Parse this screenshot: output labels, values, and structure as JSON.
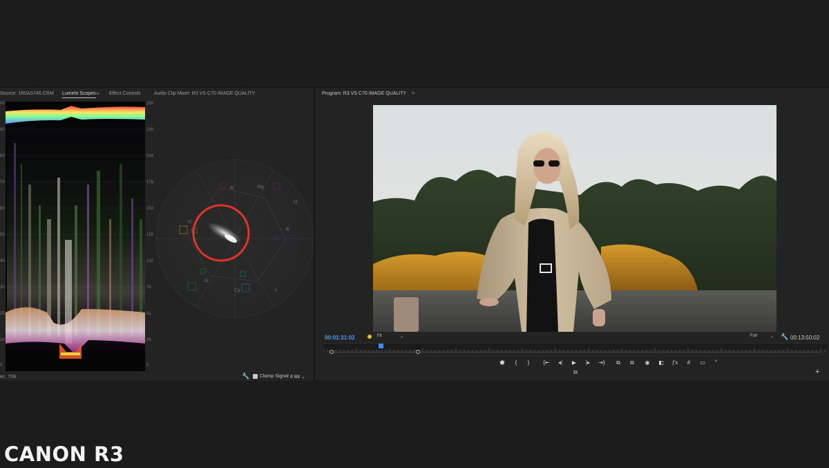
{
  "caption": "CANON R3",
  "source_panel": {
    "tabs": {
      "source": "Source: 1R0AS745.CRM",
      "lumetri": "Lumetri Scopes",
      "effect_controls": "Effect Controls",
      "audio_mixer": "Audio Clip Mixer: R3 VS C70 IMAGE QUALITY"
    },
    "waveform": {
      "right_ticks": [
        "255",
        "230",
        "204",
        "178",
        "153",
        "128",
        "102",
        "76",
        "51",
        "26",
        "0"
      ],
      "left_ticks": [
        "00",
        "90",
        "80",
        "70",
        "60",
        "50",
        "40",
        "30",
        "20",
        "10",
        "0"
      ]
    },
    "vectorscope": {
      "labels": {
        "r": "R",
        "mg": "Mg",
        "q": "Q",
        "b": "B",
        "yl": "Yl",
        "g": "G",
        "cy": "Cy",
        "i": "-I"
      },
      "highlight_color": "#e0332b"
    },
    "footer": {
      "colorspace": "ec. 709",
      "clamp_label": "Clamp Signal",
      "bit_depth": "8 Bit"
    }
  },
  "program_monitor": {
    "title": "Program: R3 VS C70 IMAGE QUALITY",
    "current_timecode": "00:01:31:02",
    "fit_value": "Fit",
    "resolution_value": "Full",
    "duration_timecode": "00:13:50:02",
    "playhead_fraction": 0.11
  },
  "colors": {
    "accent_blue": "#4e9ff0",
    "marker_yellow": "#e2c22a"
  }
}
